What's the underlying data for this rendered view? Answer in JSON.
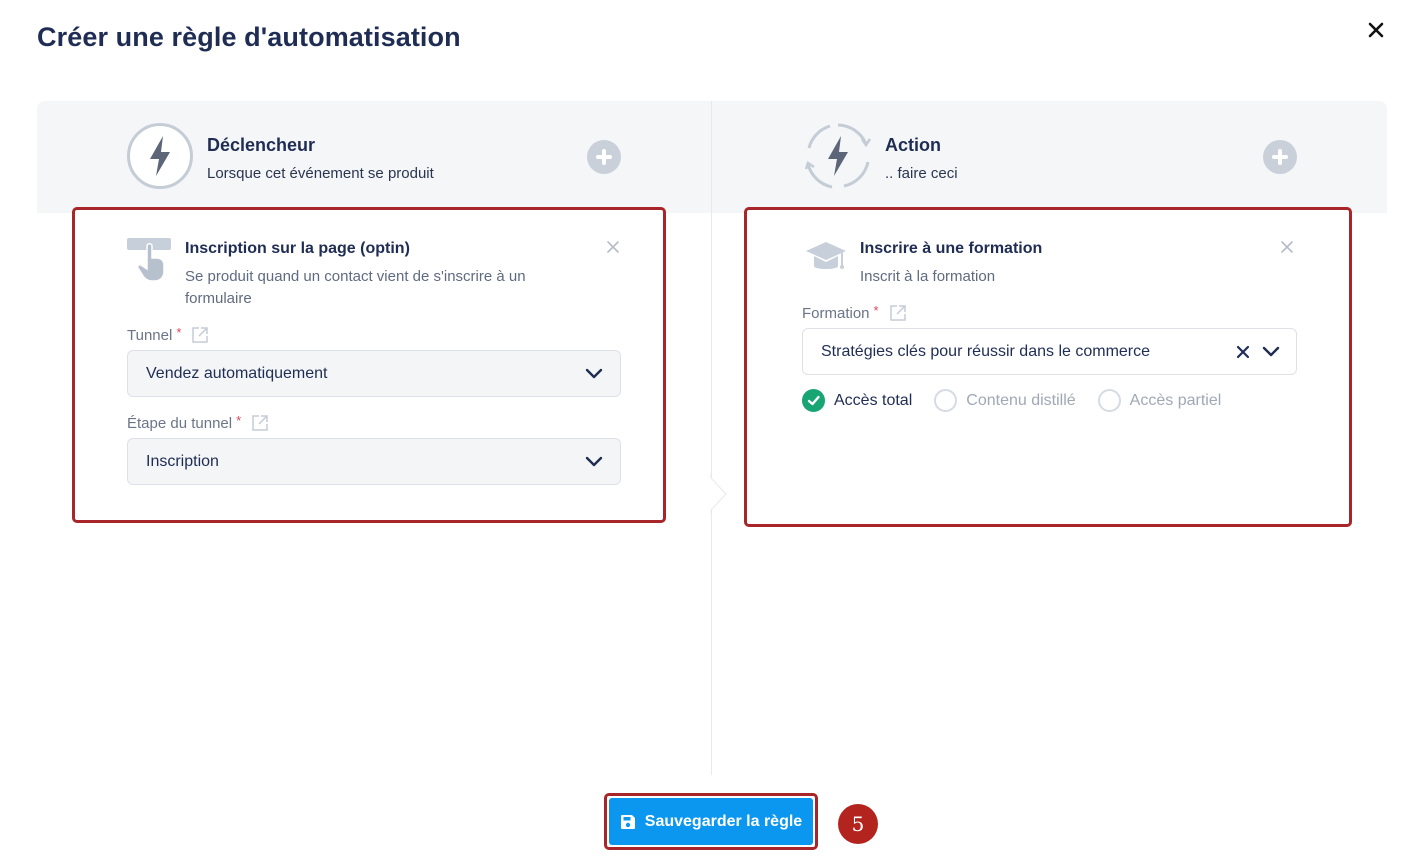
{
  "modal": {
    "title": "Créer une règle d'automatisation",
    "close_icon": "close-icon"
  },
  "trigger_column": {
    "title": "Déclencheur",
    "subtitle": "Lorsque cet événement se produit",
    "icon": "lightning-icon",
    "add_icon": "plus-circle-icon"
  },
  "action_column": {
    "title": "Action",
    "subtitle": ".. faire ceci",
    "icon": "lightning-cycle-icon",
    "add_icon": "plus-circle-icon"
  },
  "trigger_card": {
    "icon": "hand-click-icon",
    "title": "Inscription sur la page (optin)",
    "description": "Se produit quand un contact vient de s'inscrire à un formulaire",
    "fields": [
      {
        "label": "Tunnel",
        "required_mark": "*",
        "value": "Vendez automatiquement"
      },
      {
        "label": "Étape du tunnel",
        "required_mark": "*",
        "value": "Inscription"
      }
    ]
  },
  "action_card": {
    "icon": "graduation-cap-icon",
    "title": "Inscrire à une formation",
    "description": "Inscrit à la formation",
    "field": {
      "label": "Formation",
      "required_mark": "*",
      "value": "Stratégies clés pour réussir dans le commerce"
    },
    "access_options": [
      {
        "label": "Accès total",
        "selected": true
      },
      {
        "label": "Contenu distillé",
        "selected": false
      },
      {
        "label": "Accès partiel",
        "selected": false
      }
    ]
  },
  "footer": {
    "save_label": "Sauvegarder la règle",
    "step_number": "5"
  },
  "colors": {
    "primary_button": "#0b97f0",
    "highlight_border": "#a8262a",
    "selected_radio": "#17a673",
    "required_mark": "#e0475a"
  }
}
